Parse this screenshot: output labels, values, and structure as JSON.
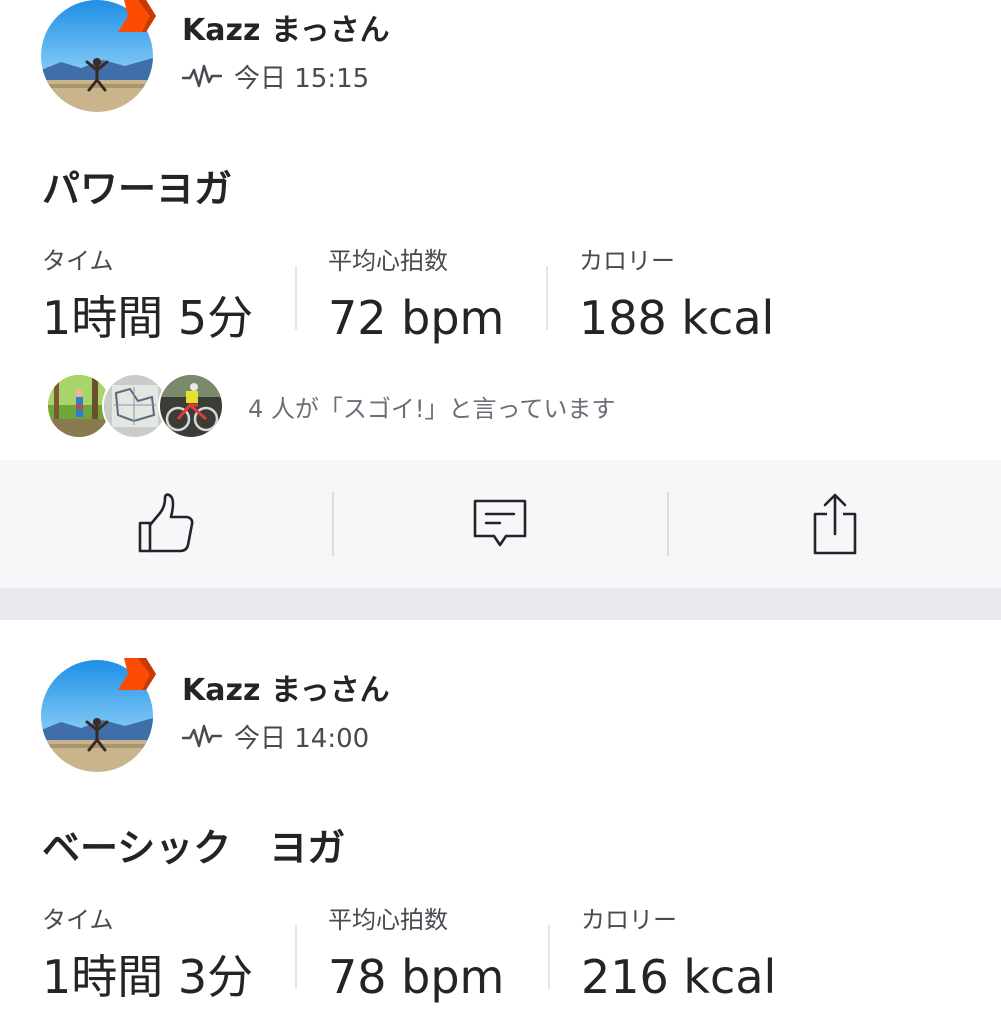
{
  "activities": [
    {
      "athlete": "Kazz まっさん",
      "time": "今日 15:15",
      "title": "パワーヨガ",
      "stats": [
        {
          "label": "タイム",
          "value": "1時間 5分"
        },
        {
          "label": "平均心拍数",
          "value": "72 bpm"
        },
        {
          "label": "カロリー",
          "value": "188 kcal"
        }
      ],
      "kudos_text": "4 人が「スゴイ!」と言っています",
      "kudos_avatars": [
        "kudo-avatar-forest-runner",
        "kudo-avatar-map",
        "kudo-avatar-cyclist"
      ]
    },
    {
      "athlete": "Kazz まっさん",
      "time": "今日 14:00",
      "title": "ベーシック　ヨガ",
      "stats": [
        {
          "label": "タイム",
          "value": "1時間 3分"
        },
        {
          "label": "平均心拍数",
          "value": "78 bpm"
        },
        {
          "label": "カロリー",
          "value": "216 kcal"
        }
      ]
    }
  ],
  "actions": {
    "kudos_icon": "thumbs-up-icon",
    "comment_icon": "comment-icon",
    "share_icon": "share-icon"
  },
  "colors": {
    "text_primary": "#242428",
    "text_secondary": "#494950",
    "text_muted": "#6d6d78",
    "badge_orange": "#fc4c02",
    "action_bar_bg": "#f7f7fa",
    "section_gap": "#e8e8ed"
  }
}
